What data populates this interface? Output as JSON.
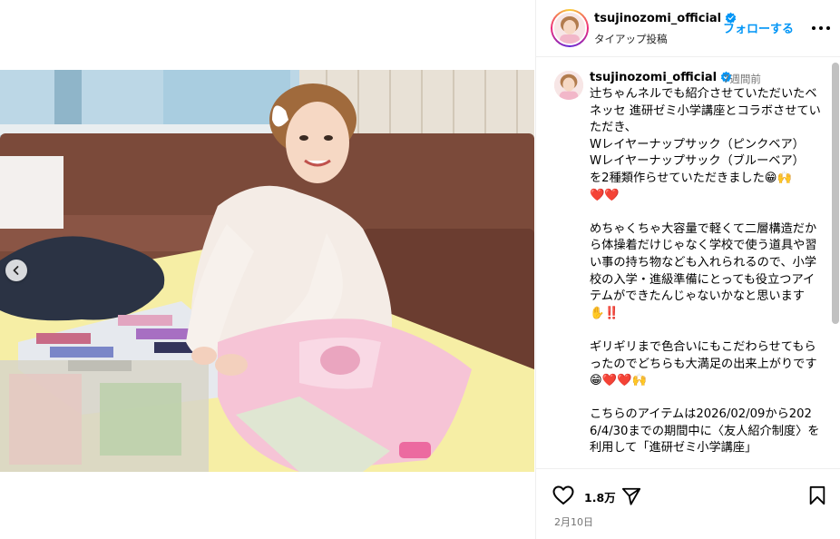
{
  "post": {
    "username": "tsujinozomi_official",
    "sub_label": "タイアップ投稿",
    "follow_label": "フォローする",
    "time_ago": "7週間前",
    "caption": "辻ちゃんネルでも紹介させていただいたベネッセ 進研ゼミ小学講座とコラボさせていただき、\nWレイヤーナップサック（ピンクベア）\nWレイヤーナップサック（ブルーベア）\nを2種類作らせていただきました😁🙌\n❤️❤️\n\nめちゃくちゃ大容量で軽くて二層構造だから体操着だけじゃなく学校で使う道具や習い事の持ち物なども入れられるので、小学校の入学・進級準備にとっても役立つアイテムができたんじゃないかなと思います✋‼️\n\nギリギリまで色合いにもこだわらせてもらったのでどちらも大満足の出来上がりです😁❤️❤️🙌\n\nこちらのアイテムは2026/02/09から2026/4/30までの期間中に〈友人紹介制度〉を利用して「進研ゼミ小学講座」",
    "like_count": "1.8万",
    "date": "2月10日"
  },
  "icons": {
    "verified": "verified-badge-icon",
    "more": "more-options-icon",
    "like": "heart-icon",
    "share": "send-icon",
    "save": "bookmark-icon",
    "carousel_prev": "chevron-left-icon"
  },
  "colors": {
    "accent": "#0095f6",
    "verified": "#0095f6",
    "secondary_text": "#737373",
    "divider": "#efefef"
  }
}
